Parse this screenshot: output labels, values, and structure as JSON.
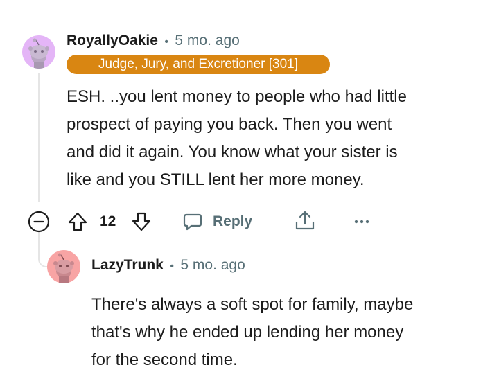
{
  "comments": [
    {
      "username": "RoyallyOakie",
      "separator": "•",
      "age": "5 mo. ago",
      "flair": "Judge, Jury, and Excretioner [301]",
      "body_lines": [
        "ESH. ..you lent money to people who had little",
        "prospect of paying you back. Then you went",
        "and did it again. You know what your sister is",
        "like and you STILL lent her more money."
      ],
      "actions": {
        "vote_count": "12",
        "reply_label": "Reply"
      }
    },
    {
      "username": "LazyTrunk",
      "separator": "•",
      "age": "5 mo. ago",
      "body_lines": [
        "There's always a soft spot for family, maybe",
        "that's why he ended up lending her money",
        "for the second time."
      ]
    }
  ],
  "colors": {
    "flair_bg": "#d98612",
    "avatar_1": "#e4b5f7",
    "avatar_2": "#f8a4a4",
    "muted_text": "#576f76"
  },
  "icons": [
    "snoo-avatar-icon",
    "collapse-icon",
    "upvote-icon",
    "downvote-icon",
    "reply-icon",
    "share-icon",
    "more-options-icon"
  ]
}
